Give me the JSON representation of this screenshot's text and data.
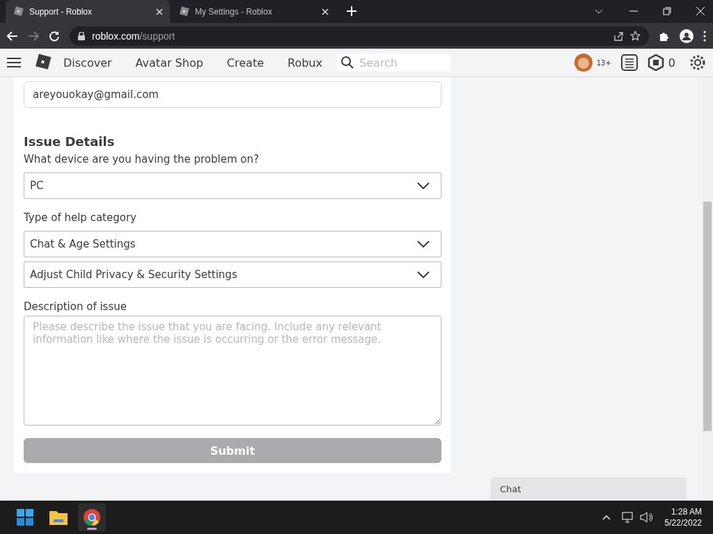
{
  "browser": {
    "tabs": [
      {
        "title": "Support - Roblox",
        "selected": true
      },
      {
        "title": "My Settings - Roblox",
        "selected": false
      }
    ],
    "url": {
      "domain": "roblox.com",
      "path": "/support"
    }
  },
  "nav": {
    "items": [
      "Discover",
      "Avatar Shop",
      "Create",
      "Robux"
    ],
    "search": {
      "placeholder": "Search"
    },
    "age": "13+",
    "robux": "0"
  },
  "form": {
    "email": "areyouokay@gmail.com",
    "section_title": "Issue Details",
    "fields": [
      {
        "kind": "select",
        "label": "What device are you having the problem on?",
        "value": "PC"
      },
      {
        "kind": "select",
        "label": "Type of help category",
        "value": "Chat & Age Settings"
      },
      {
        "kind": "select",
        "value": "Adjust Child Privacy & Security Settings"
      },
      {
        "kind": "textarea",
        "label": "Description of issue",
        "placeholder": "Please describe the issue that you are facing. Include any relevant information like where the issue is occurring or the error message."
      }
    ],
    "submit": {
      "label": "Submit",
      "disabled": true
    }
  },
  "chat": {
    "label": "Chat"
  },
  "taskbar": {
    "apps": [
      {
        "kind": "start",
        "selected": false
      },
      {
        "kind": "files",
        "selected": false
      },
      {
        "kind": "browser",
        "selected": true
      }
    ],
    "time": "1:28 AM",
    "date": "5/22/2022"
  }
}
